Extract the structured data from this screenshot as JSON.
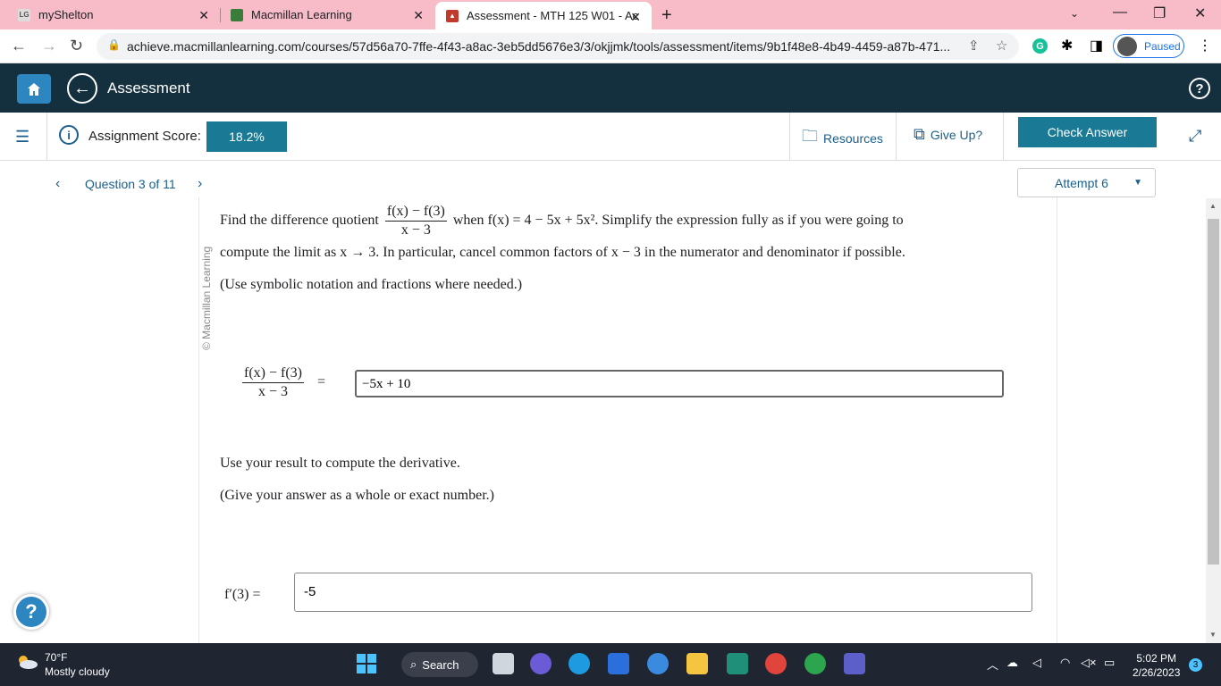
{
  "browser": {
    "tabs": [
      {
        "label": "myShelton",
        "favicon": "LG"
      },
      {
        "label": "Macmillan Learning"
      },
      {
        "label": "Assessment - MTH 125 W01 - Ac"
      }
    ],
    "url": "achieve.macmillanlearning.com/courses/57d56a70-7ffe-4f43-a8ac-3eb5dd5676e3/3/okjjmk/tools/assessment/items/9b1f48e8-4b49-4459-a87b-471...",
    "profile_status": "Paused",
    "extension_letter": "G"
  },
  "app": {
    "title": "Assessment",
    "score_label": "Assignment Score:",
    "score_value": "18.2%",
    "resources_label": "Resources",
    "give_up_label": "Give Up?",
    "check_answer_label": "Check Answer",
    "question_label": "Question 3 of 11",
    "attempt_label": "Attempt 6",
    "watermark": "© Macmillan Learning",
    "accent": "#1a7a96",
    "header_color": "#14303f"
  },
  "question": {
    "p1_a": "Find the difference quotient",
    "frac_num": "f(x) − f(3)",
    "frac_den": "x − 3",
    "p1_b": "when f(x) = 4 − 5x + 5x². Simplify the expression fully as if you were going to",
    "p2": "compute the limit as x → 3. In particular, cancel common factors of x − 3 in the numerator and denominator if possible.",
    "p3": "(Use symbolic notation and fractions where needed.)",
    "eq_sign": "=",
    "answer1": "−5x + 10",
    "p4": "Use your result to compute the derivative.",
    "p5": "(Give your answer as a whole or exact number.)",
    "deriv_label": "f′(3) =",
    "answer2": "-5"
  },
  "taskbar": {
    "temperature": "70°F",
    "weather": "Mostly cloudy",
    "search_label": "Search",
    "time": "5:02 PM",
    "date": "2/26/2023",
    "notification_count": "3"
  }
}
